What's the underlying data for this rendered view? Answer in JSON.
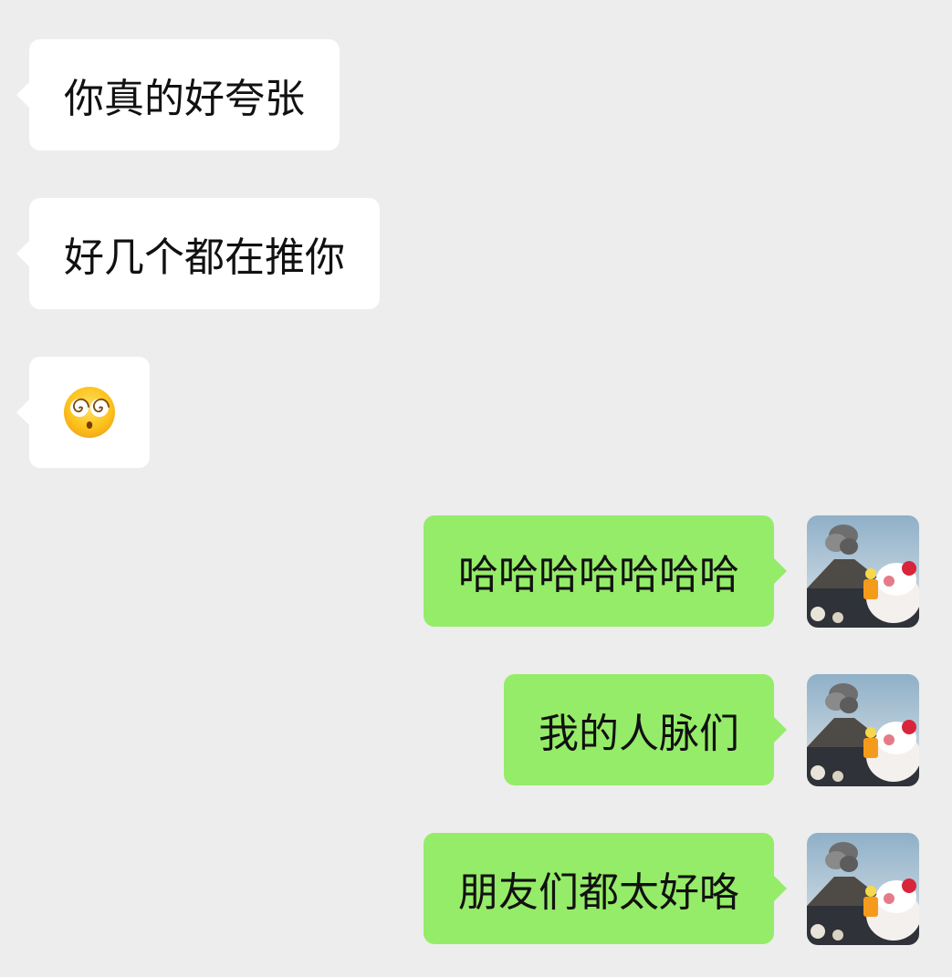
{
  "messages": [
    {
      "side": "incoming",
      "text": "你真的好夸张"
    },
    {
      "side": "incoming",
      "text": "好几个都在推你"
    },
    {
      "side": "incoming",
      "emoji": "dizzy-face-emoji",
      "text": ""
    },
    {
      "side": "outgoing",
      "text": "哈哈哈哈哈哈哈"
    },
    {
      "side": "outgoing",
      "text": "我的人脉们"
    },
    {
      "side": "outgoing",
      "text": "朋友们都太好咯"
    }
  ],
  "colors": {
    "background": "#ededed",
    "incoming_bubble": "#ffffff",
    "outgoing_bubble": "#95ec69",
    "text": "#111111"
  },
  "avatar": {
    "icon": "user-avatar-volcano-image"
  }
}
